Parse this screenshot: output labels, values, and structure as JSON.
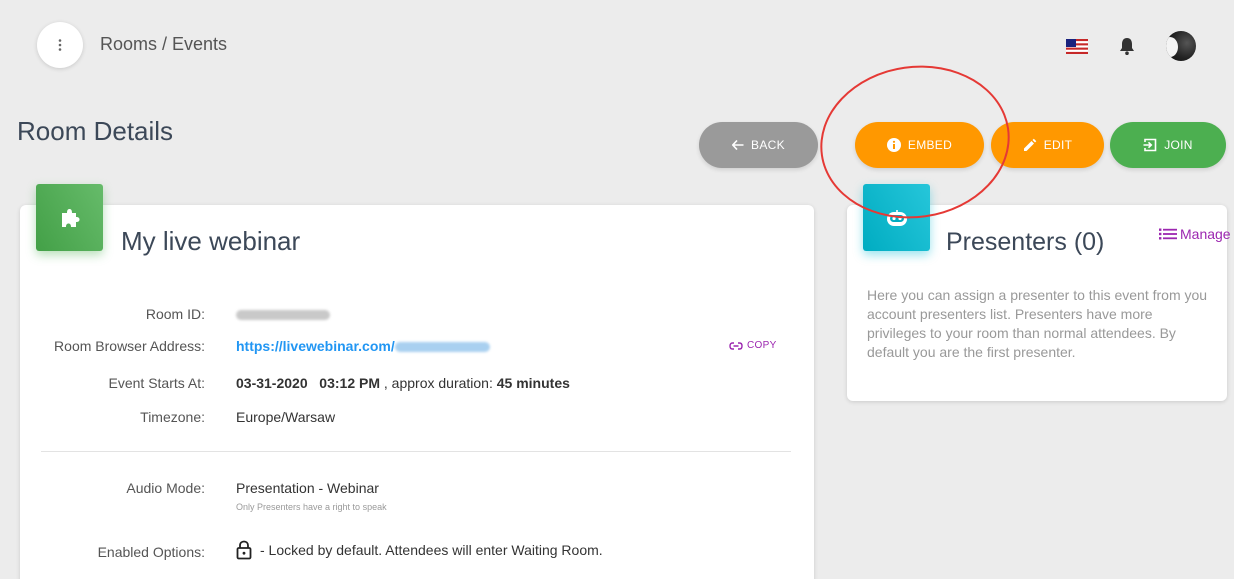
{
  "header": {
    "breadcrumb": "Rooms / Events"
  },
  "page": {
    "title": "Room Details"
  },
  "actions": {
    "back": "BACK",
    "embed": "EMBED",
    "edit": "EDIT",
    "join": "JOIN"
  },
  "room": {
    "name": "My live webinar",
    "rows": {
      "room_id_label": "Room ID:",
      "address_label": "Room Browser Address:",
      "address_link": "https://livewebinar.com/",
      "copy_label": "COPY",
      "event_label": "Event Starts At:",
      "event_date": "03-31-2020",
      "event_time": "03:12 PM",
      "event_sep": ", approx duration:",
      "event_duration": "45 minutes",
      "timezone_label": "Timezone:",
      "timezone_value": "Europe/Warsaw",
      "audio_label": "Audio Mode:",
      "audio_value": "Presentation - Webinar",
      "audio_note": "Only Presenters have a right to speak",
      "options_label": "Enabled Options:",
      "options_value": " - Locked by default. Attendees will enter Waiting Room."
    }
  },
  "presenters": {
    "title": "Presenters (0)",
    "manage_label": "Manage",
    "description": "Here you can assign a presenter to this event from you account presenters list. Presenters have more privileges to your room than normal attendees. By default you are the first presenter."
  },
  "icons": {
    "menu": "more-vert-icon",
    "flag": "us-flag-icon",
    "bell": "bell-icon",
    "back": "arrow-left-icon",
    "embed": "info-icon",
    "edit": "pencil-icon",
    "join": "login-icon",
    "room_badge": "puzzle-icon",
    "presenters_badge": "robot-icon",
    "copy": "link-icon",
    "manage": "list-icon",
    "lock": "lock-icon"
  },
  "colors": {
    "orange": "#ff9800",
    "green": "#4caf50",
    "cyan": "#00bcd4",
    "purple": "#9c27b0",
    "link_blue": "#2196f3",
    "annotation_red": "#e53935"
  }
}
